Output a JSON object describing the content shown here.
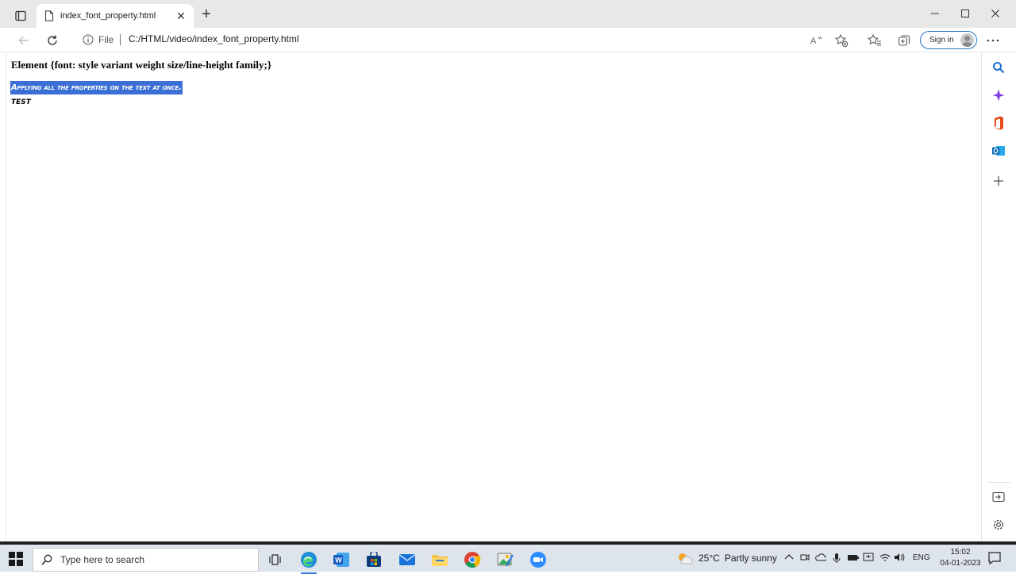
{
  "browser": {
    "tab_title": "index_font_property.html",
    "address": {
      "scheme_label": "File",
      "url": "C:/HTML/video/index_font_property.html"
    },
    "signin_label": "Sign in"
  },
  "page": {
    "heading": "Element {font: style variant weight size/line-height family;}",
    "selected_text": "Applying all the properties on the text at once.",
    "test_text": "TEST"
  },
  "taskbar": {
    "search_placeholder": "Type here to search",
    "weather": {
      "temp": "25°C",
      "condition": "Partly sunny"
    },
    "language": "ENG",
    "time": "15:02",
    "date": "04-01-2023"
  },
  "colors": {
    "selection": "#3b6fd6",
    "accent": "#2b79c2"
  }
}
